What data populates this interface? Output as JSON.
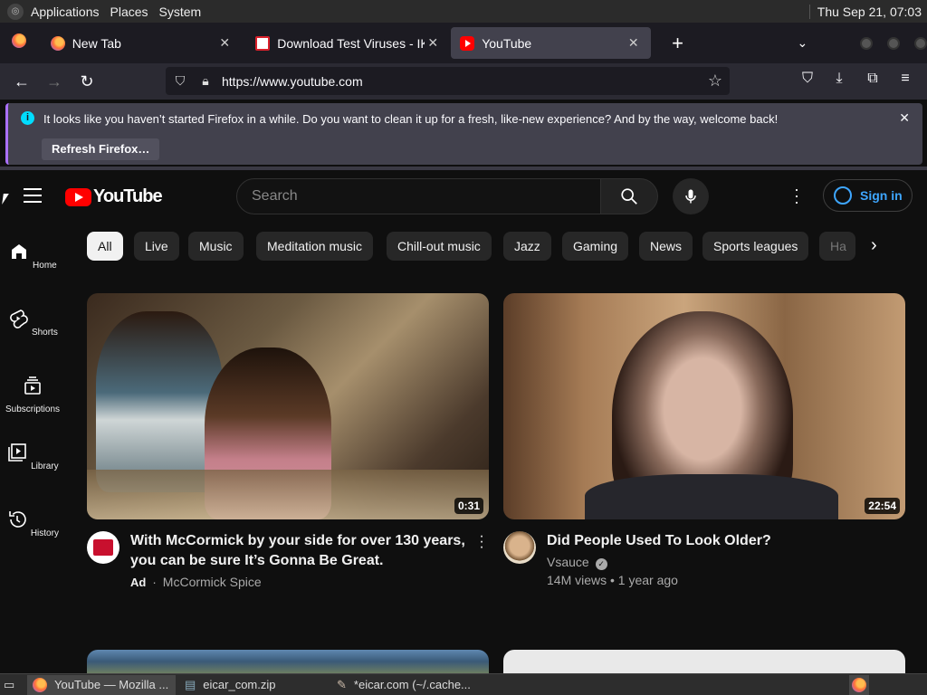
{
  "top_panel": {
    "menu": [
      "Applications",
      "Places",
      "System"
    ],
    "clock": "Thu Sep 21, 07:03"
  },
  "browser": {
    "tabs": [
      {
        "label": "New Tab",
        "icon": "firefox-icon"
      },
      {
        "label": "Download Test Viruses - IKARUS",
        "icon": "ikarus-icon"
      },
      {
        "label": "YouTube",
        "icon": "youtube-icon",
        "active": true
      }
    ],
    "new_tab_symbol": "+",
    "url": "https://www.youtube.com",
    "notification": {
      "message": "It looks like you haven’t started Firefox in a while. Do you want to clean it up for a fresh, like-new experience? And by the way, welcome back!",
      "button": "Refresh Firefox…"
    }
  },
  "youtube": {
    "logo_text": "YouTube",
    "search_placeholder": "Search",
    "sign_in": "Sign in",
    "guide": [
      {
        "label": "Home",
        "icon": "home-icon"
      },
      {
        "label": "Shorts",
        "icon": "shorts-icon"
      },
      {
        "label": "Subscriptions",
        "icon": "subscriptions-icon"
      },
      {
        "label": "Library",
        "icon": "library-icon"
      },
      {
        "label": "History",
        "icon": "history-icon"
      }
    ],
    "chips": [
      "All",
      "Live",
      "Music",
      "Meditation music",
      "Chill-out music",
      "Jazz",
      "Gaming",
      "News",
      "Sports leagues",
      "Ha"
    ],
    "videos": [
      {
        "title_line1": "With McCormick by your side for over 130 years,",
        "title_line2": "you can be sure It’s Gonna Be Great.",
        "ad_label": "Ad",
        "channel": "McCormick Spice",
        "duration": "0:31"
      },
      {
        "title_line1": "Did People Used To Look Older?",
        "channel": "Vsauce",
        "meta": "14M views • 1 year ago",
        "duration": "22:54"
      }
    ]
  },
  "taskbar": {
    "items": [
      "YouTube — Mozilla ...",
      "eicar_com.zip",
      "*eicar.com (~/.cache..."
    ]
  },
  "colors": {
    "yt_red": "#ff0000",
    "yt_bg": "#0f0f0f",
    "link_blue": "#3ea6ff",
    "ff_toolbar": "#2b2a33"
  }
}
